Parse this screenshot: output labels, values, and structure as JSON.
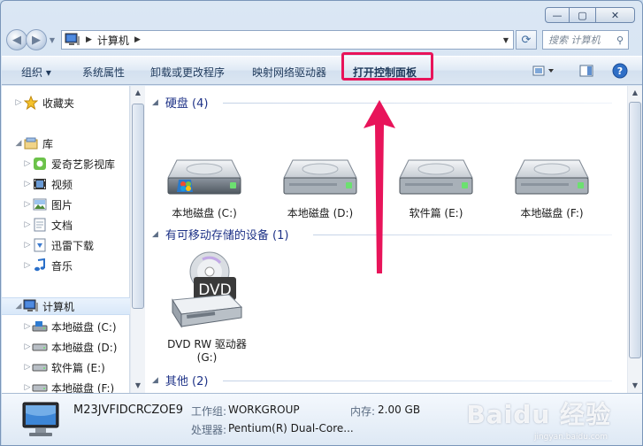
{
  "window": {
    "minimize_glyph": "—",
    "maximize_glyph": "▢",
    "close_glyph": "✕"
  },
  "address": {
    "back_glyph": "◀",
    "forward_glyph": "▶",
    "location": "计算机",
    "search_placeholder": "搜索 计算机"
  },
  "toolbar": {
    "organize": "组织 ▾",
    "system_properties": "系统属性",
    "uninstall": "卸载或更改程序",
    "map_drive": "映射网络驱动器",
    "control_panel": "打开控制面板"
  },
  "sidebar": {
    "favorites": "收藏夹",
    "library": "库",
    "library_items": [
      "爱奇艺影视库",
      "视频",
      "图片",
      "文档",
      "迅雷下载",
      "音乐"
    ],
    "computer": "计算机",
    "computer_items": [
      "本地磁盘 (C:)",
      "本地磁盘 (D:)",
      "软件篇 (E:)",
      "本地磁盘 (F:)"
    ]
  },
  "content": {
    "hard_disks_header": "硬盘 (4)",
    "drives": [
      "本地磁盘 (C:)",
      "本地磁盘 (D:)",
      "软件篇 (E:)",
      "本地磁盘 (F:)"
    ],
    "removable_header": "有可移动存储的设备 (1)",
    "dvd_badge": "DVD",
    "dvd_label_line1": "DVD RW 驱动器",
    "dvd_label_line2": "(G:)",
    "other_header": "其他 (2)"
  },
  "details": {
    "computer_name": "M23JVFIDCRCZOE9",
    "workgroup_key": "工作组:",
    "workgroup_value": "WORKGROUP",
    "memory_key": "内存:",
    "memory_value": "2.00 GB",
    "cpu_key": "处理器:",
    "cpu_value": "Pentium(R) Dual-Core..."
  },
  "watermark": {
    "text": "Baidu 经验",
    "sub": "jingyan.baidu.com"
  },
  "colors": {
    "highlight": "#e8145a",
    "arrow": "#e8145a",
    "group_header": "#1e3287"
  }
}
